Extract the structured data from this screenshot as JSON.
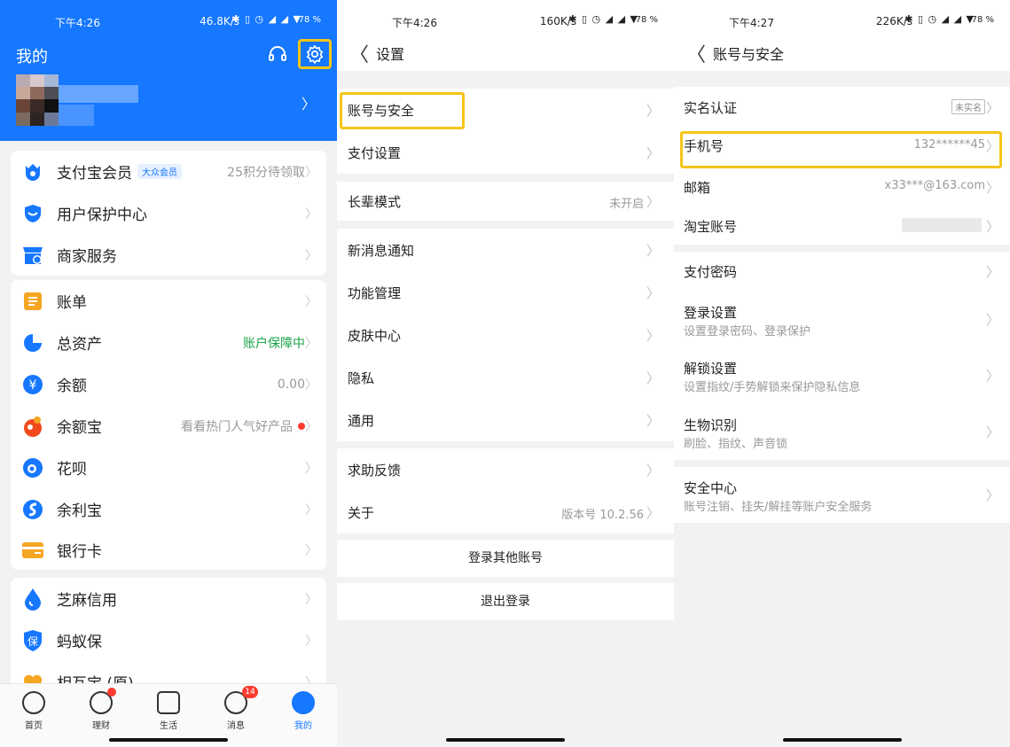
{
  "colors": {
    "primary": "#1677ff",
    "highlight": "#f5c518",
    "green": "#1ba548",
    "red": "#ff3b30"
  },
  "panel1": {
    "status": {
      "time": "下午4:26",
      "net": "46.8K/s",
      "battery": "78 %"
    },
    "title": "我的",
    "header_icons": [
      "headset-icon",
      "gear-icon"
    ],
    "groups": [
      [
        {
          "label": "支付宝会员",
          "badge": "大众会员",
          "value": "25积分待领取",
          "icon": "member-icon",
          "icon_color": "#1677ff"
        },
        {
          "label": "用户保护中心",
          "value": "",
          "icon": "shield-icon",
          "icon_color": "#1677ff"
        },
        {
          "label": "商家服务",
          "value": "",
          "icon": "store-icon",
          "icon_color": "#1677ff"
        }
      ],
      [
        {
          "label": "账单",
          "value": "",
          "icon": "bill-icon",
          "icon_color": "#f5a623"
        },
        {
          "label": "总资产",
          "value": "账户保障中",
          "value_color": "#1ba548",
          "icon": "pie-icon",
          "icon_color": "#1677ff"
        },
        {
          "label": "余额",
          "value": "0.00",
          "icon": "yuan-icon",
          "icon_color": "#1677ff"
        },
        {
          "label": "余额宝",
          "value": "看看热门人气好产品",
          "dot": true,
          "icon": "yuebao-icon",
          "icon_color": "#f04a1d"
        },
        {
          "label": "花呗",
          "value": "",
          "icon": "huabei-icon",
          "icon_color": "#1677ff"
        },
        {
          "label": "余利宝",
          "value": "",
          "icon": "yulibao-icon",
          "icon_color": "#1677ff"
        },
        {
          "label": "银行卡",
          "value": "",
          "icon": "card-icon",
          "icon_color": "#f5a623"
        }
      ],
      [
        {
          "label": "芝麻信用",
          "value": "",
          "icon": "sesame-icon",
          "icon_color": "#1677ff"
        },
        {
          "label": "蚂蚁保",
          "value": "",
          "icon": "bao-icon",
          "icon_color": "#1677ff"
        },
        {
          "label": "相互宝 (原)",
          "value": "",
          "icon": "heart-icon",
          "icon_color": "#f5a623"
        }
      ]
    ],
    "tabs": [
      {
        "label": "首页",
        "icon": "home-icon"
      },
      {
        "label": "理财",
        "icon": "finance-icon",
        "dot": true
      },
      {
        "label": "生活",
        "icon": "life-icon"
      },
      {
        "label": "消息",
        "icon": "message-icon",
        "badge": "14"
      },
      {
        "label": "我的",
        "icon": "profile-icon",
        "active": true
      }
    ]
  },
  "panel2": {
    "status": {
      "time": "下午4:26",
      "net": "160K/s",
      "battery": "78 %"
    },
    "title": "设置",
    "groups": [
      [
        {
          "label": "账号与安全",
          "value": ""
        },
        {
          "label": "支付设置",
          "value": ""
        }
      ],
      [
        {
          "label": "长辈模式",
          "value": "未开启"
        }
      ],
      [
        {
          "label": "新消息通知",
          "value": ""
        },
        {
          "label": "功能管理",
          "value": ""
        },
        {
          "label": "皮肤中心",
          "value": ""
        },
        {
          "label": "隐私",
          "value": ""
        },
        {
          "label": "通用",
          "value": ""
        }
      ],
      [
        {
          "label": "求助反馈",
          "value": ""
        },
        {
          "label": "关于",
          "value": "版本号 10.2.56"
        }
      ]
    ],
    "buttons": [
      "登录其他账号",
      "退出登录"
    ]
  },
  "panel3": {
    "status": {
      "time": "下午4:27",
      "net": "226K/s",
      "battery": "78 %"
    },
    "title": "账号与安全",
    "group1": [
      {
        "label": "实名认证",
        "tag": "未实名"
      },
      {
        "label": "手机号",
        "value": "132******45"
      },
      {
        "label": "邮箱",
        "value": "x33***@163.com"
      },
      {
        "label": "淘宝账号",
        "value": ""
      }
    ],
    "group2": [
      {
        "label": "支付密码",
        "sub": ""
      },
      {
        "label": "登录设置",
        "sub": "设置登录密码、登录保护"
      },
      {
        "label": "解锁设置",
        "sub": "设置指纹/手势解锁来保护隐私信息"
      },
      {
        "label": "生物识别",
        "sub": "刷脸、指纹、声音锁"
      }
    ],
    "group3": [
      {
        "label": "安全中心",
        "sub": "账号注销、挂失/解挂等账户安全服务"
      }
    ]
  }
}
